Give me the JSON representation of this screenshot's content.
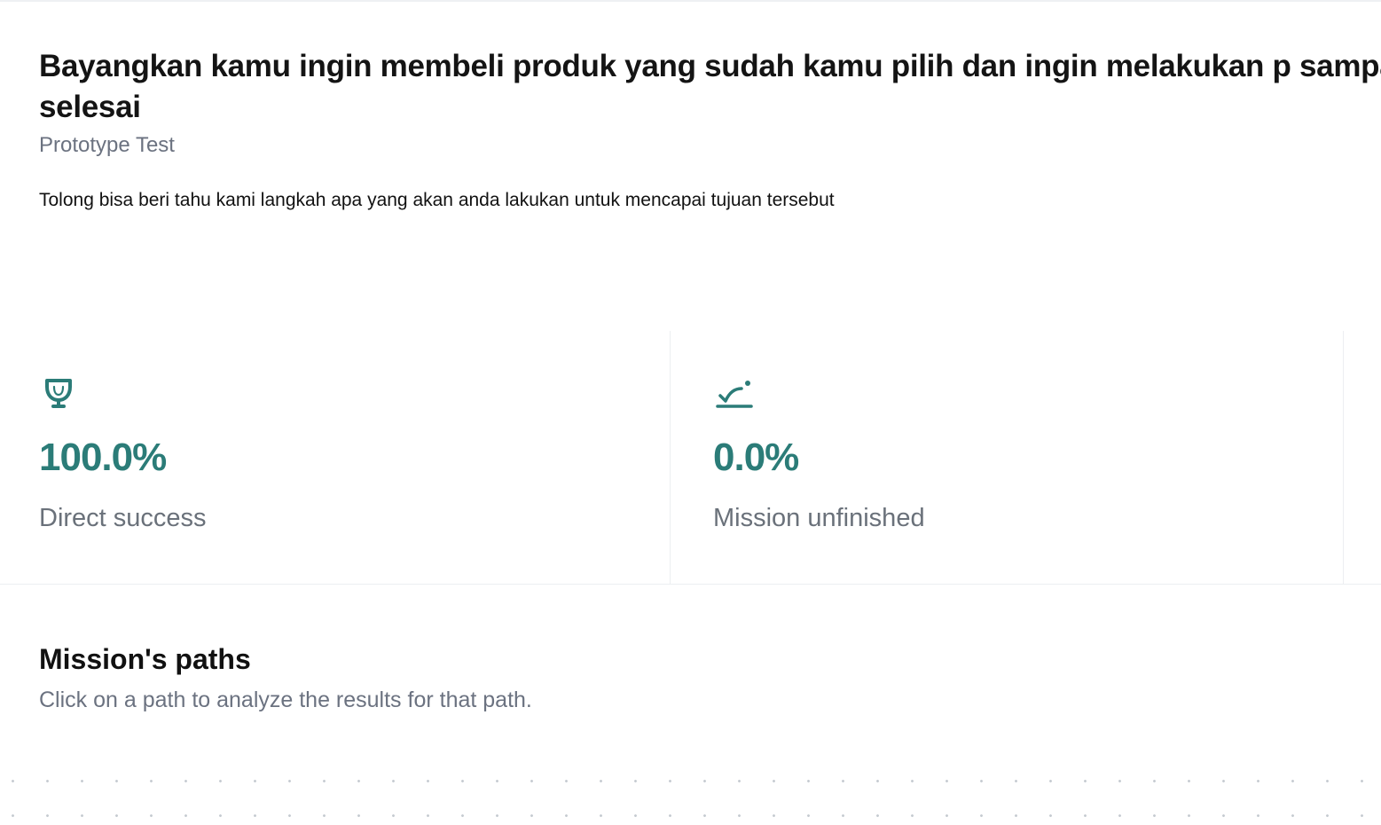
{
  "task": {
    "title": "Bayangkan kamu ingin membeli produk yang sudah kamu pilih dan ingin melakukan p sampai selesai",
    "type": "Prototype Test",
    "description": "Tolong bisa beri tahu kami langkah apa yang akan anda lakukan untuk mencapai tujuan tersebut"
  },
  "stats": [
    {
      "icon": "trophy-icon",
      "value": "100.0%",
      "label": "Direct success"
    },
    {
      "icon": "mission-unfinished-icon",
      "value": "0.0%",
      "label": "Mission unfinished"
    }
  ],
  "paths": {
    "title": "Mission's paths",
    "subtitle": "Click on a path to analyze the results for that path."
  },
  "colors": {
    "accent": "#2b7c78",
    "muted_text": "#6b7280",
    "divider": "#eceef1"
  }
}
